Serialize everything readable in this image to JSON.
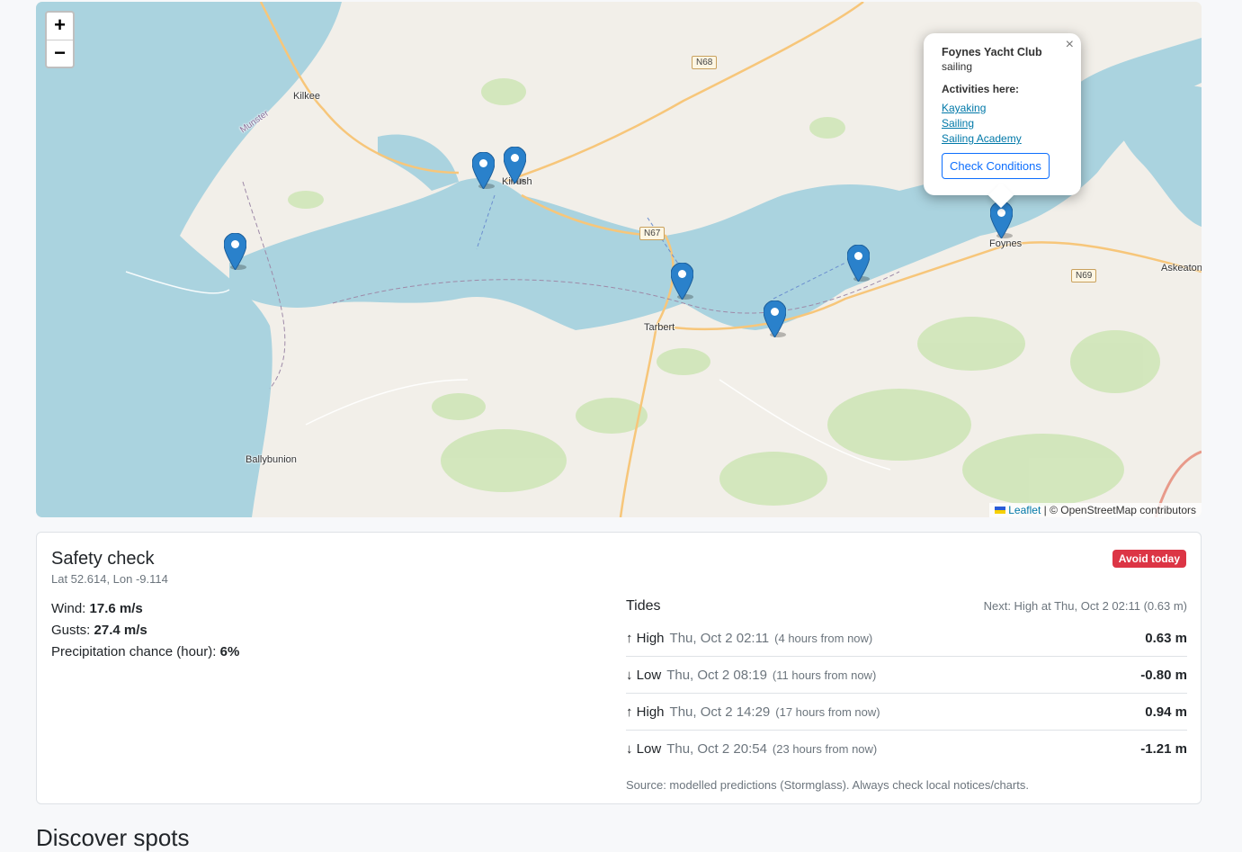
{
  "map": {
    "zoom_in": "+",
    "zoom_out": "−",
    "places": [
      "Kilkee",
      "Kilrush",
      "Foynes",
      "Askeaton",
      "Tarbert",
      "Ballybunion",
      "Munster"
    ],
    "roads": [
      "N68",
      "N67",
      "N69"
    ],
    "attribution": {
      "leaflet": "Leaflet",
      "rest": " | © OpenStreetMap contributors"
    },
    "popup": {
      "close": "×",
      "name": "Foynes Yacht Club",
      "kind": "sailing",
      "activities_title": "Activities here:",
      "activities": [
        "Kayaking",
        "Sailing",
        "Sailing Academy"
      ],
      "button": "Check Conditions"
    }
  },
  "safety": {
    "title": "Safety check",
    "coords": "Lat 52.614, Lon -9.114",
    "badge": "Avoid today",
    "wind_label": "Wind: ",
    "wind": "17.6 m/s",
    "gusts_label": "Gusts: ",
    "gusts": "27.4 m/s",
    "precip_label": "Precipitation chance (hour): ",
    "precip": "6%",
    "tides": {
      "title": "Tides",
      "next": "Next: High at Thu, Oct 2 02:11 (0.63 m)",
      "rows": [
        {
          "type": "↑ High",
          "when": "Thu, Oct 2 02:11",
          "rel": "(4 hours from now)",
          "height": "0.63 m"
        },
        {
          "type": "↓ Low",
          "when": "Thu, Oct 2 08:19",
          "rel": "(11 hours from now)",
          "height": "-0.80 m"
        },
        {
          "type": "↑ High",
          "when": "Thu, Oct 2 14:29",
          "rel": "(17 hours from now)",
          "height": "0.94 m"
        },
        {
          "type": "↓ Low",
          "when": "Thu, Oct 2 20:54",
          "rel": "(23 hours from now)",
          "height": "-1.21 m"
        }
      ],
      "source": "Source: modelled predictions (Stormglass). Always check local notices/charts."
    }
  },
  "discover_title": "Discover spots",
  "colors": {
    "water": "#aad3df",
    "land": "#f2efe9",
    "marker": "#2a81cb",
    "danger": "#dc3545",
    "primary": "#0d6efd"
  }
}
